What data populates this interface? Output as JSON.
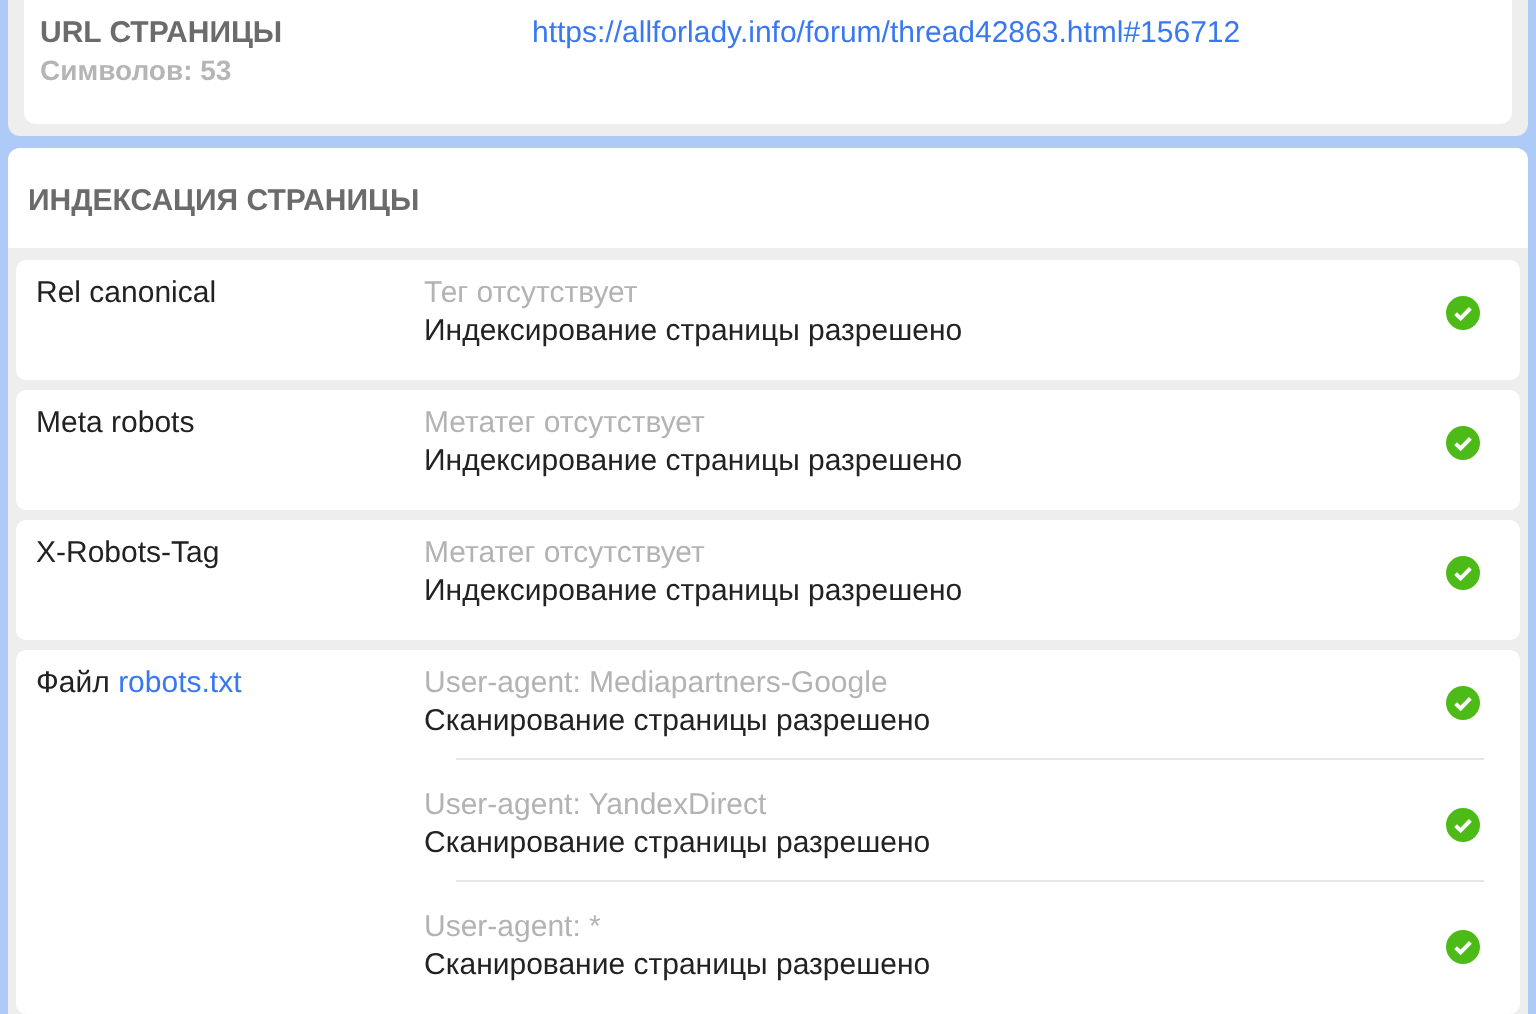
{
  "url_section": {
    "title": "URL СТРАНИЦЫ",
    "count": "Символов: 53",
    "url": "https://allforlady.info/forum/thread42863.html#156712"
  },
  "indexing": {
    "title": "ИНДЕКСАЦИЯ СТРАНИЦЫ",
    "rows": [
      {
        "label": "Rel canonical",
        "entries": [
          {
            "note": "Тег отсутствует",
            "message": "Индексирование страницы разрешено",
            "passed": true
          }
        ]
      },
      {
        "label": "Meta robots",
        "entries": [
          {
            "note": "Метатег отсутствует",
            "message": "Индексирование страницы разрешено",
            "passed": true
          }
        ]
      },
      {
        "label": "X-Robots-Tag",
        "entries": [
          {
            "note": "Метатег отсутствует",
            "message": "Индексирование страницы разрешено",
            "passed": true
          }
        ]
      },
      {
        "label": "Файл",
        "link": "robots.txt",
        "entries": [
          {
            "note": "User-agent: Mediapartners-Google",
            "message": "Сканирование страницы разрешено",
            "passed": true
          },
          {
            "note": "User-agent: YandexDirect",
            "message": "Сканирование страницы разрешено",
            "passed": true
          },
          {
            "note": "User-agent: *",
            "message": "Сканирование страницы разрешено",
            "passed": true
          }
        ]
      }
    ]
  }
}
